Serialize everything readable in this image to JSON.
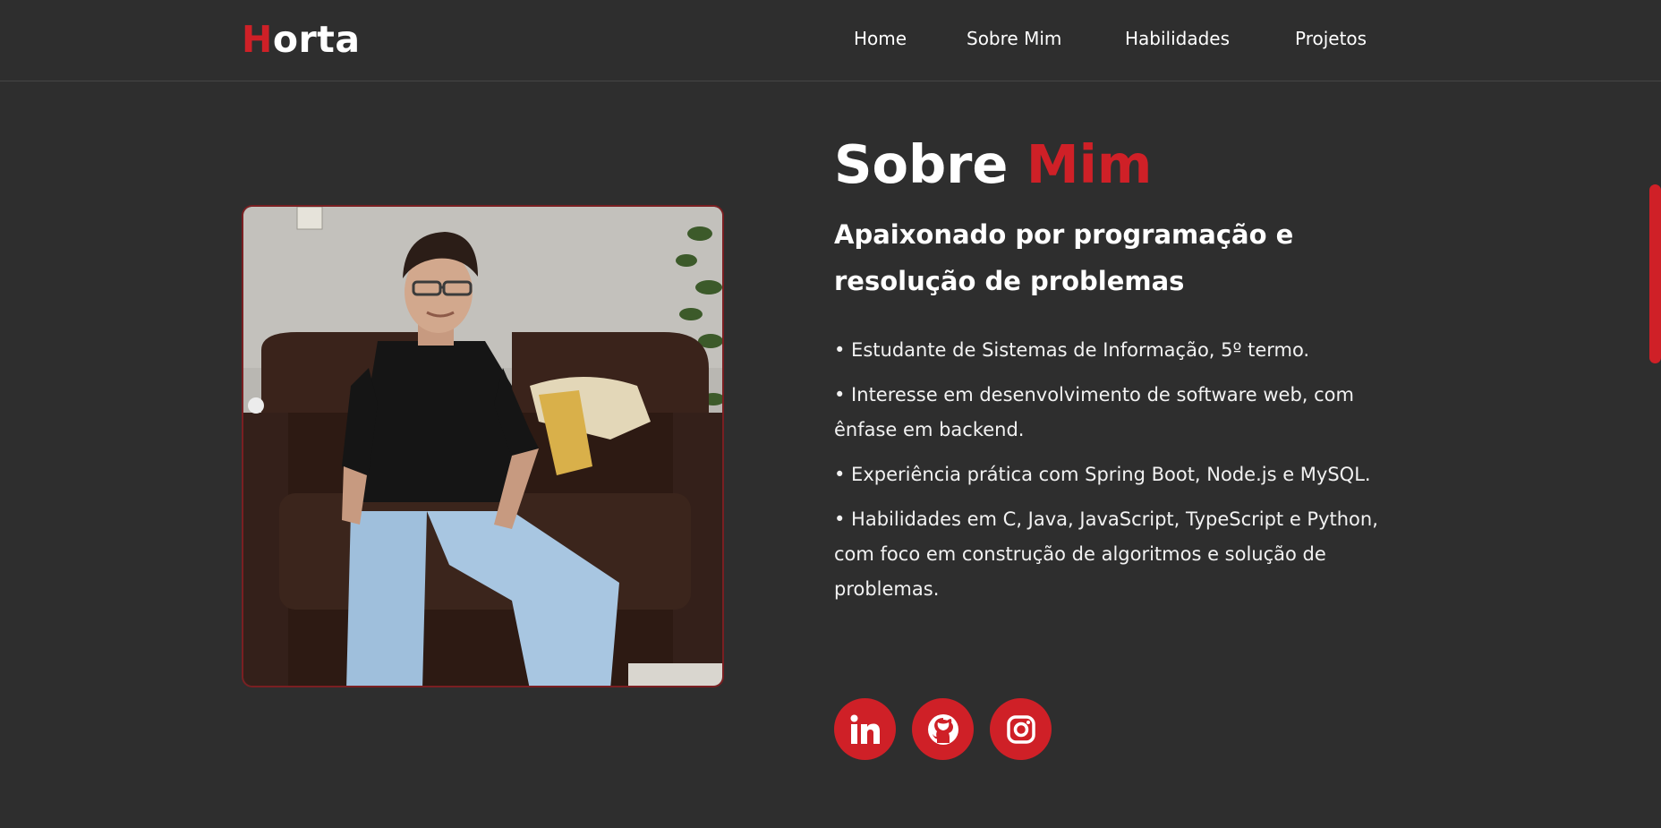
{
  "header": {
    "logo_first": "H",
    "logo_rest": "orta",
    "nav": [
      {
        "label": "Home"
      },
      {
        "label": "Sobre Mim"
      },
      {
        "label": "Habilidades"
      },
      {
        "label": "Projetos"
      }
    ]
  },
  "about": {
    "title_first": "Sobre",
    "title_accent": "Mim",
    "subtitle": "Apaixonado por programação e resolução de problemas",
    "bullets": [
      "• Estudante de Sistemas de Informação, 5º termo.",
      "• Interesse em desenvolvimento de software web, com ênfase em backend.",
      "• Experiência prática com Spring Boot, Node.js e MySQL.",
      "• Habilidades em C, Java, JavaScript, TypeScript e Python, com foco em construção de algoritmos e solução de problemas."
    ]
  },
  "social": [
    {
      "icon": "linkedin-icon"
    },
    {
      "icon": "github-icon"
    },
    {
      "icon": "instagram-icon"
    }
  ],
  "colors": {
    "background": "#2e2e2e",
    "accent": "#cf2027",
    "text": "#ffffff"
  }
}
